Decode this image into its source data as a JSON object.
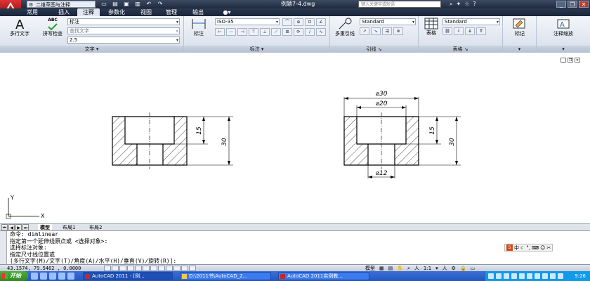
{
  "titlebar": {
    "workspace": "二维草图与注释",
    "doc_title": "例题7-4.dwg",
    "search_placeholder": "键入关键字或短语"
  },
  "tabs": [
    {
      "label": "常用"
    },
    {
      "label": "插入"
    },
    {
      "label": "注释"
    },
    {
      "label": "参数化"
    },
    {
      "label": "视图"
    },
    {
      "label": "管理"
    },
    {
      "label": "输出"
    }
  ],
  "ribbon": {
    "text_panel": {
      "mtext_label": "多行文字",
      "spell_label": "拼写检查",
      "abc": "ABC",
      "style_value": "标注",
      "find_placeholder": "查找文字",
      "height_value": "2.5",
      "title": "文字"
    },
    "dim_panel": {
      "dim_label": "标注",
      "dimstyle_value": "ISO-35",
      "title": "标注"
    },
    "leader_panel": {
      "mleader_label": "多重引线",
      "style_value": "Standard",
      "title": "引线"
    },
    "table_panel": {
      "table_label": "表格",
      "style_value": "Standard",
      "title": "表格"
    },
    "markup_panel": {
      "label": "标记"
    },
    "scale_panel": {
      "label": "注释缩放"
    }
  },
  "drawing": {
    "left_dims": {
      "d15": "15",
      "d30": "30"
    },
    "right_dims": {
      "d30h": "⌀30",
      "d20h": "⌀20",
      "d12h": "⌀12",
      "d15": "15",
      "d30": "30"
    },
    "ucs_x": "X",
    "ucs_y": "Y"
  },
  "layout_tabs": [
    {
      "label": "模型"
    },
    {
      "label": "布局1"
    },
    {
      "label": "布局2"
    }
  ],
  "command": {
    "lines": [
      "命令: dimlinear",
      "指定第一个延伸线原点或 <选择对象>:",
      "选择标注对象:",
      "指定尺寸线位置或",
      "[多行文字(M)/文字(T)/角度(A)/水平(H)/垂直(V)/旋转(R)]:"
    ]
  },
  "ime": {
    "logo": "S",
    "lang": "中"
  },
  "status": {
    "coords": "43.1574, 79.5462 , 0.0000",
    "model_label": "模型",
    "scale": "1:1"
  },
  "taskbar": {
    "start": "开始",
    "tasks": [
      {
        "label": "AutoCAD 2011 - [例..."
      },
      {
        "label": "D:\\2011书\\AutoCAD_2..."
      },
      {
        "label": "AutoCAD 2011实例教..."
      }
    ],
    "clock": "9:26"
  }
}
